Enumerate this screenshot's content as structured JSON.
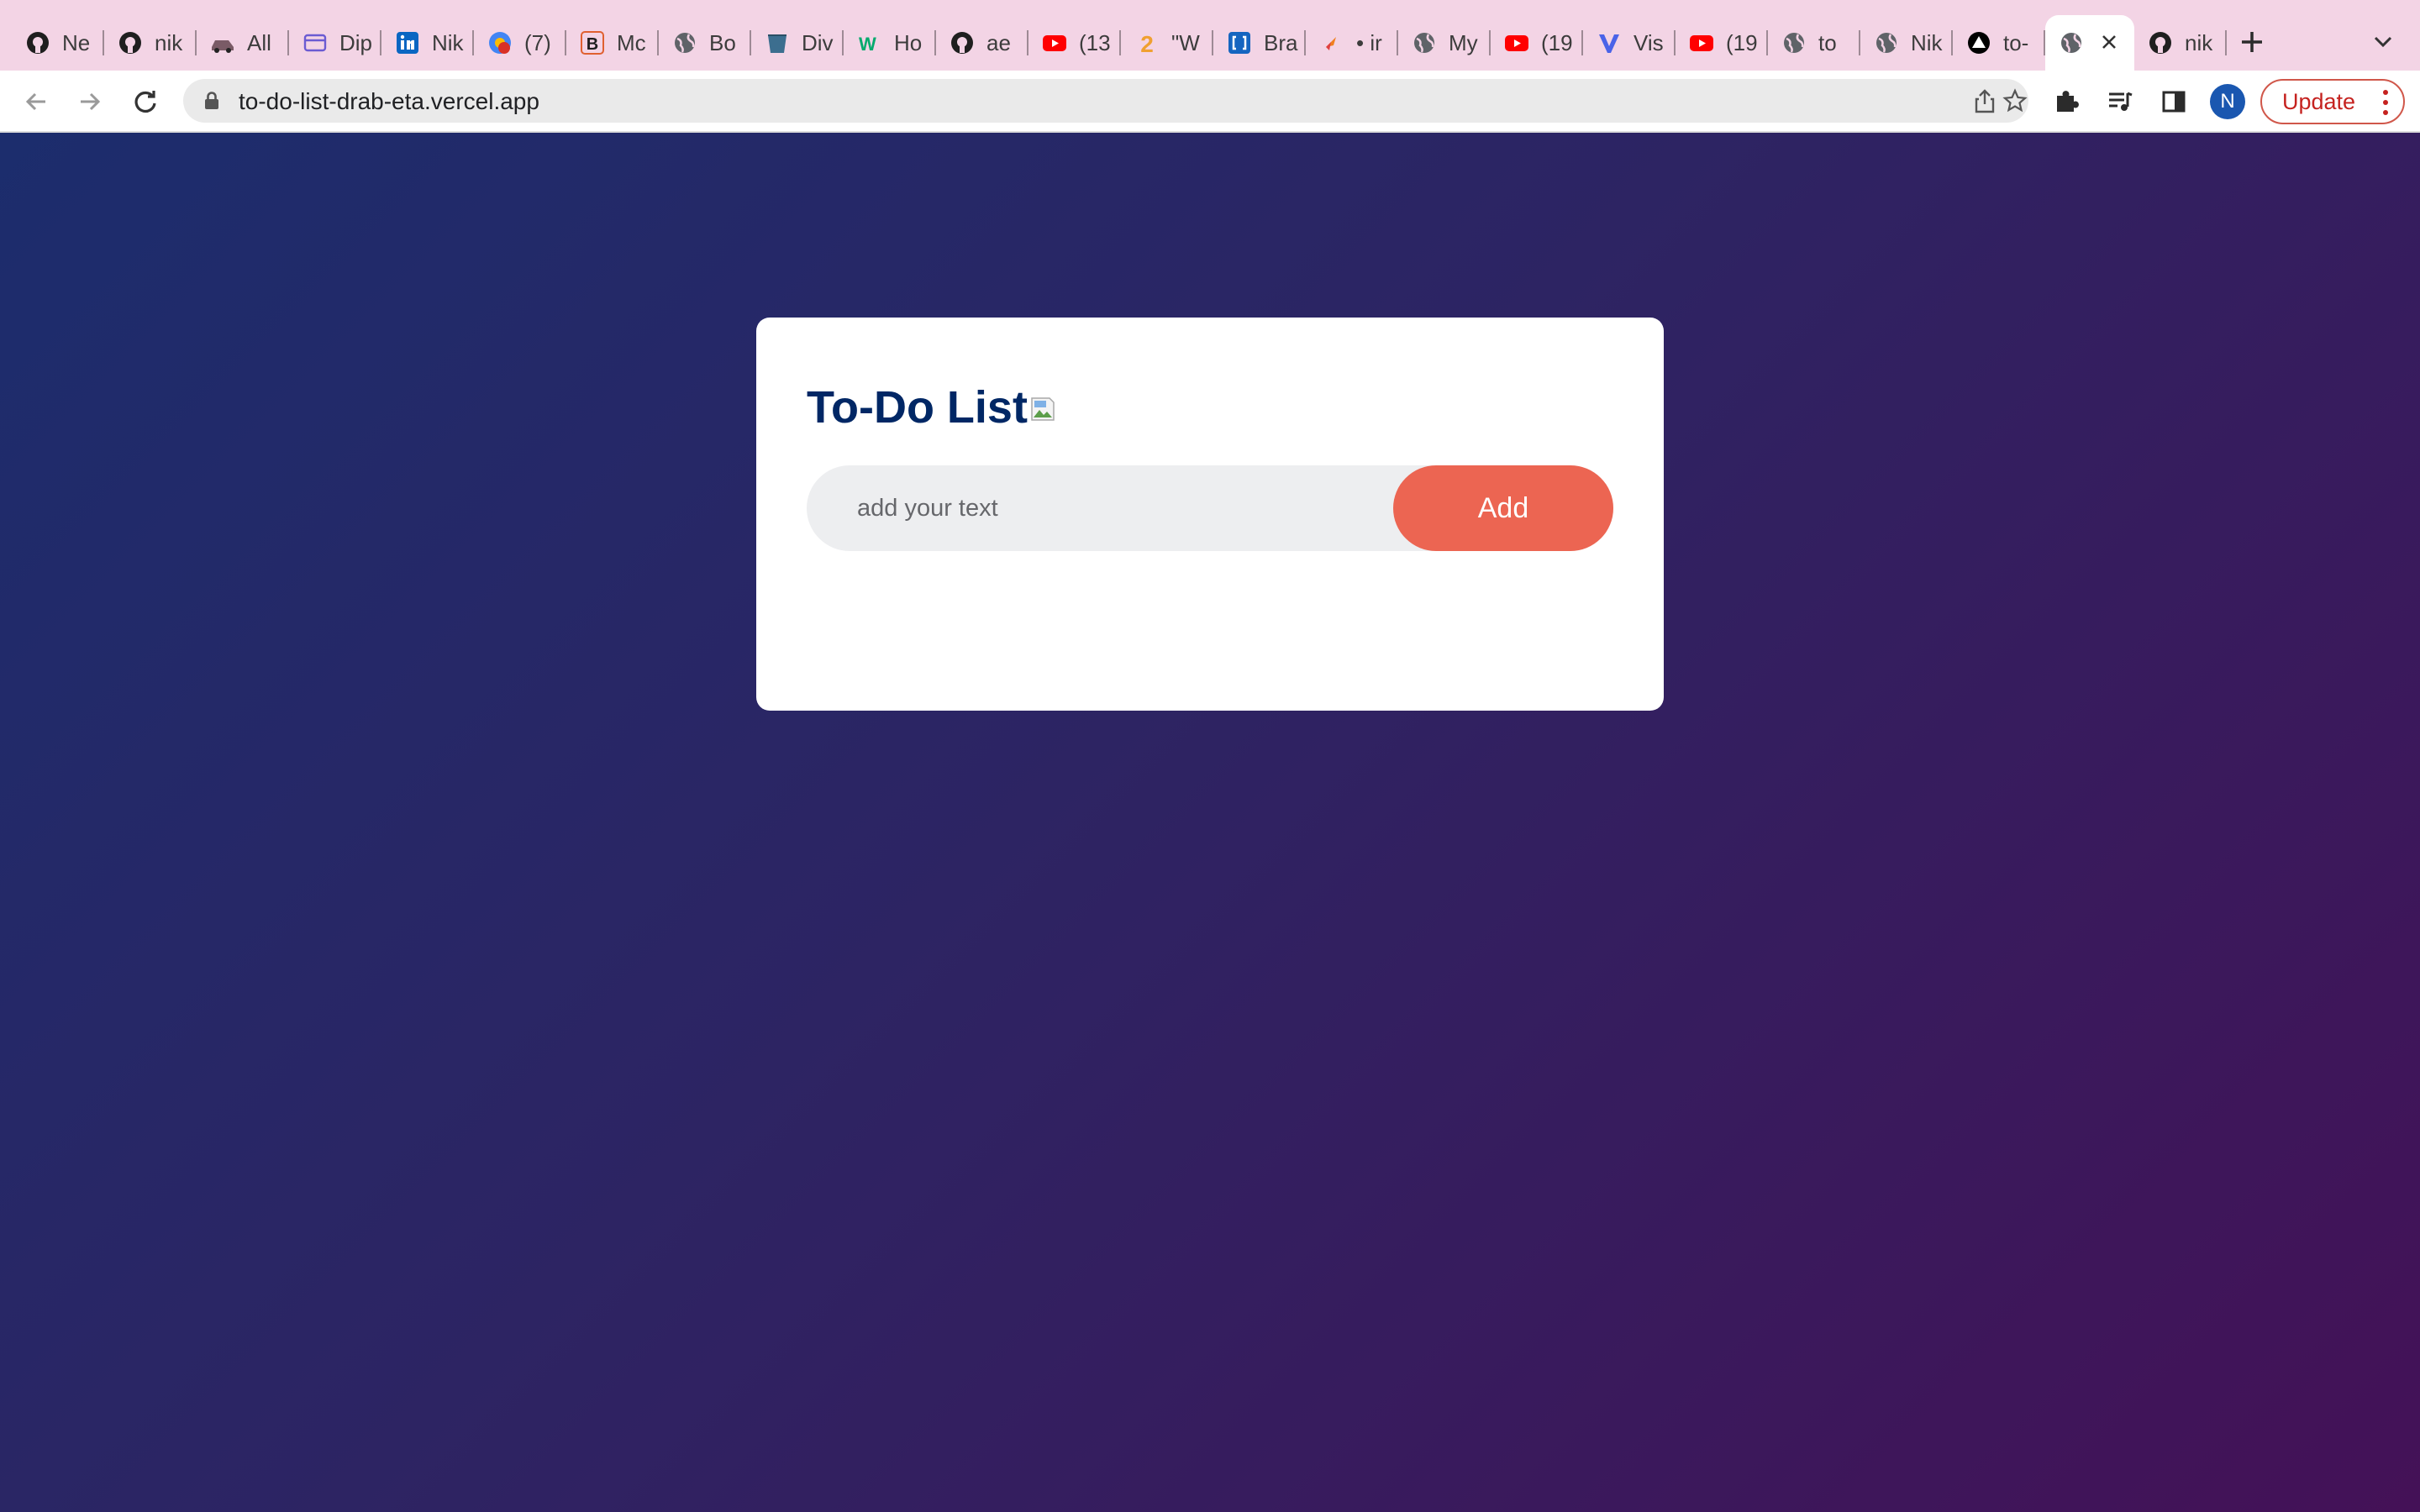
{
  "browser": {
    "tabs": [
      {
        "label": "Ne",
        "icon": "github-icon"
      },
      {
        "label": "nik",
        "icon": "github-icon"
      },
      {
        "label": "All",
        "icon": "car-icon"
      },
      {
        "label": "Dip",
        "icon": "card-icon"
      },
      {
        "label": "Nik",
        "icon": "linkedin-icon"
      },
      {
        "label": "(7)",
        "icon": "notification-icon"
      },
      {
        "label": "Mc",
        "icon": "b-icon"
      },
      {
        "label": "Bo",
        "icon": "globe-icon"
      },
      {
        "label": "Div",
        "icon": "bucket-icon"
      },
      {
        "label": "Ho",
        "icon": "w3-icon"
      },
      {
        "label": "ae",
        "icon": "github-icon"
      },
      {
        "label": "(13",
        "icon": "youtube-icon"
      },
      {
        "label": "\"W",
        "icon": "number-two-icon"
      },
      {
        "label": "Bra",
        "icon": "bracket-icon"
      },
      {
        "label": "• ir",
        "icon": "spark-icon"
      },
      {
        "label": "My",
        "icon": "globe-icon"
      },
      {
        "label": "(19",
        "icon": "youtube-icon"
      },
      {
        "label": "Vis",
        "icon": "v-icon"
      },
      {
        "label": "(19",
        "icon": "youtube-icon"
      },
      {
        "label": "to",
        "icon": "globe-icon"
      },
      {
        "label": "Nik",
        "icon": "globe-icon"
      },
      {
        "label": "to-",
        "icon": "vercel-icon"
      },
      {
        "label": "",
        "icon": "globe-icon",
        "active": true
      },
      {
        "label": "nik",
        "icon": "github-icon"
      }
    ],
    "url": "to-do-list-drab-eta.vercel.app",
    "profile_initial": "N",
    "update_label": "Update"
  },
  "app": {
    "title": "To-Do List",
    "input_placeholder": "add your text",
    "input_value": "",
    "add_label": "Add"
  },
  "colors": {
    "tabstrip_bg": "#f3d4e5",
    "card_bg": "#ffffff",
    "title_color": "#002765",
    "input_bg": "#edeef0",
    "add_button_bg": "#ec6552",
    "gradient_start": "#1c2d6d",
    "gradient_end": "#441157"
  }
}
